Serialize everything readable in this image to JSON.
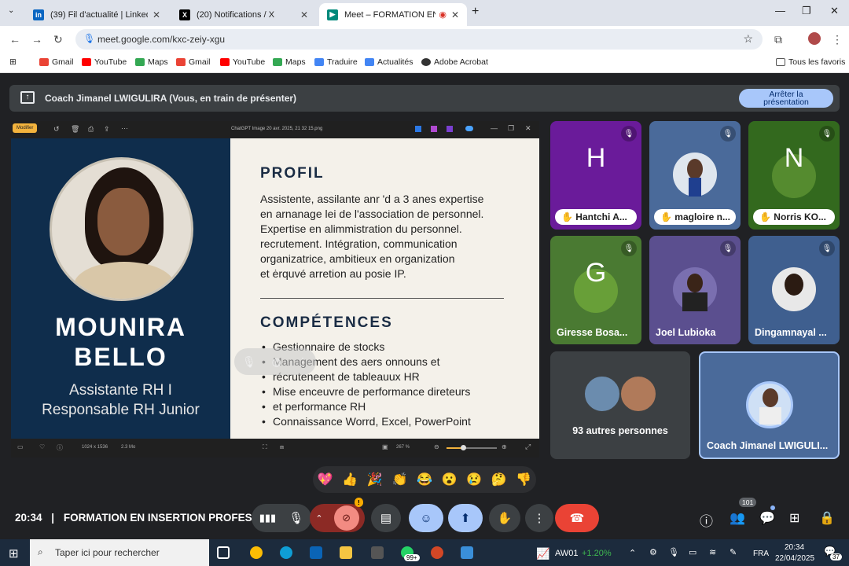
{
  "browser": {
    "tabs": [
      {
        "label": "(39) Fil d'actualité | LinkedIn",
        "icon": "linkedin-icon"
      },
      {
        "label": "(20) Notifications / X",
        "icon": "x-icon"
      },
      {
        "label": "Meet – FORMATION EN INS",
        "icon": "meet-icon"
      }
    ],
    "url": "meet.google.com/kxc-zeiy-xgu",
    "bookmarks": [
      "Gmail",
      "YouTube",
      "Maps",
      "Gmail",
      "YouTube",
      "Maps",
      "Traduire",
      "Actualités",
      "Adobe Acrobat"
    ],
    "all_bookmarks": "Tous les favoris"
  },
  "presenting": {
    "title": "Coach Jimanel LWIGULIRA (Vous, en train de présenter)",
    "stop_line1": "Arrêter la",
    "stop_line2": "présentation"
  },
  "viewer": {
    "edit": "Modifier",
    "filename": "ChatGPT Image 20 avr. 2025, 21 32 15.png",
    "dims": "1024 x 1536",
    "size": "2.3 Mo",
    "zoom": "267 %"
  },
  "cv": {
    "name_line1": "MOUNIRA",
    "name_line2": "BELLO",
    "role_line1": "Assistante RH I",
    "role_line2": "Responsable RH Junior",
    "profil_heading": "PROFIL",
    "profil_lines": [
      "Assistente, assilante anr 'd a 3 anes expertise",
      "en arnanage lei de l'association de personnel.",
      "Expertise en alimmistration du personnel.",
      "recrutement. Intégration, communication",
      "organizatrice, ambitieux en organization",
      "et ėrquvé arretion au posie IP."
    ],
    "comp_heading": "COMPÉTENCES",
    "skills": [
      "Gestionnaire de stocks",
      "Management des aers onnouns et",
      "récruteneent de tableauux HR",
      "Mise enceuvre de performance direteurs",
      "et performance RH",
      "Connaissance Worrd, Excel, PowerPoint"
    ]
  },
  "participants": [
    {
      "letter": "H",
      "name": "Hantchi A...",
      "bg": "#6a1b9a"
    },
    {
      "letter": "",
      "name": "magloire n...",
      "bg": "#4a6a9a"
    },
    {
      "letter": "N",
      "name": "Norris KO...",
      "bg": "#33691e"
    },
    {
      "letter": "G",
      "name": "Giresse Bosa...",
      "bg": "#4a7a32"
    },
    {
      "letter": "",
      "name": "Joel Lubioka",
      "bg": "#5b4f8f"
    },
    {
      "letter": "",
      "name": "Dingamnayal ...",
      "bg": "#3f5f8f"
    }
  ],
  "others": "93 autres personnes",
  "self_name": "Coach Jimanel LWIGULI...",
  "reactions": [
    "💖",
    "👍",
    "🎉",
    "👏",
    "😂",
    "😮",
    "😢",
    "🤔",
    "👎"
  ],
  "meeting": {
    "time": "20:34",
    "separator": "|",
    "title": "FORMATION EN INSERTION PROFESS...",
    "people_count": "101",
    "warn": "!"
  },
  "taskbar": {
    "search": "Taper ici pour rechercher",
    "whatsapp_badge": "99+",
    "stock": "AW01",
    "stock_change": "+1.20%",
    "lang": "FRA",
    "time": "20:34",
    "date": "22/04/2025",
    "notif": "37"
  }
}
